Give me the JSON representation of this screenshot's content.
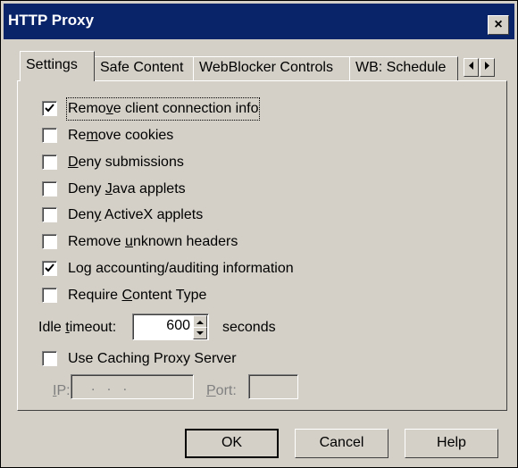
{
  "window": {
    "title": "HTTP Proxy",
    "close_label": "×"
  },
  "tabs": [
    {
      "label": "Settings",
      "active": true
    },
    {
      "label": "Safe Content",
      "active": false
    },
    {
      "label": "WebBlocker Controls",
      "active": false
    },
    {
      "label": "WB: Schedule",
      "active": false
    }
  ],
  "tab_scroll": {
    "left_icon": "arrow-left-icon",
    "right_icon": "arrow-right-icon"
  },
  "checkboxes": [
    {
      "pre": "Remo",
      "u": "v",
      "post": "e client connection info",
      "checked": true,
      "focused": true
    },
    {
      "pre": "Re",
      "u": "m",
      "post": "ove cookies",
      "checked": false,
      "focused": false
    },
    {
      "pre": "",
      "u": "D",
      "post": "eny submissions",
      "checked": false,
      "focused": false
    },
    {
      "pre": "Deny ",
      "u": "J",
      "post": "ava applets",
      "checked": false,
      "focused": false
    },
    {
      "pre": "Den",
      "u": "y",
      "post": " ActiveX applets",
      "checked": false,
      "focused": false
    },
    {
      "pre": "Remove ",
      "u": "u",
      "post": "nknown headers",
      "checked": false,
      "focused": false
    },
    {
      "pre": "Lo",
      "u": "g",
      "post": " accounting/auditing information",
      "checked": true,
      "focused": false
    },
    {
      "pre": "Require ",
      "u": "C",
      "post": "ontent Type",
      "checked": false,
      "focused": false
    }
  ],
  "idle_timeout": {
    "pre": "Idle ",
    "u": "t",
    "post": "imeout:",
    "value": "600",
    "unit": "seconds"
  },
  "caching": {
    "label": "Use Caching Proxy Server",
    "checked": false
  },
  "ip": {
    "u": "I",
    "post": "P:",
    "value": ".   .   ."
  },
  "port": {
    "u": "P",
    "post": "ort:",
    "value": ""
  },
  "buttons": {
    "ok": "OK",
    "cancel": "Cancel",
    "help": "Help"
  }
}
